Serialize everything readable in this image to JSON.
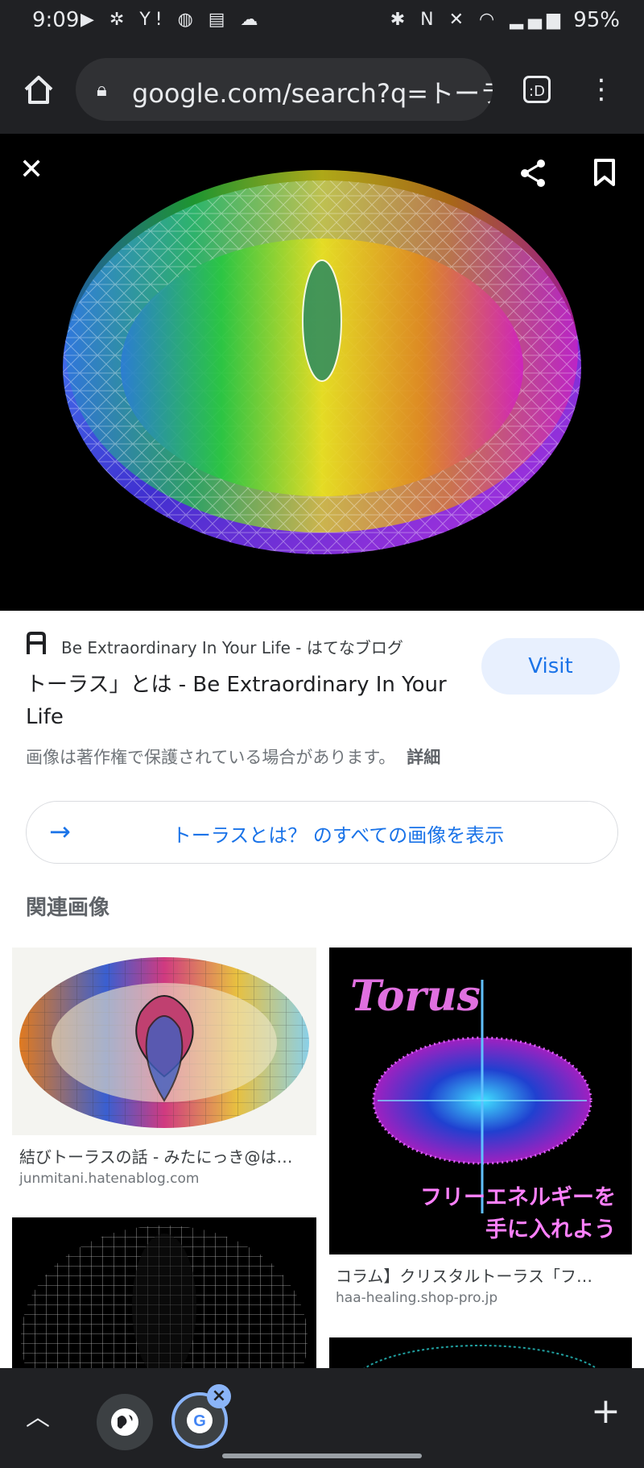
{
  "status": {
    "time": "9:09",
    "left_icons": "▶ ✲ Y! ◍ ▤ ☁",
    "right_icons": "✱ N ✕ ◠ ▂▄▆",
    "battery": "95%"
  },
  "browser": {
    "url": "google.com/search?q=トーラ",
    "tab_count": ":D"
  },
  "result": {
    "source": "Be Extraordinary In Your Life - はてなブログ",
    "title": "トーラス」とは - Be Extraordinary In Your Life",
    "visit_label": "Visit",
    "copyright": "画像は著作権で保護されている場合があります。",
    "detail_label": "詳細",
    "view_all_label": "トーラスとは？ のすべての画像を表示"
  },
  "related": {
    "heading": "関連画像",
    "items": [
      {
        "caption": "結びトーラスの話 - みたにっき@は…",
        "domain": "junmitani.hatenablog.com"
      },
      {
        "caption": "コラム】クリスタルトーラス「フ…",
        "domain": "haa-healing.shop-pro.jp",
        "image_text_1": "Torus",
        "image_text_2": "フリーエネルギーを",
        "image_text_3": "手に入れよう"
      }
    ]
  },
  "colors": {
    "accent": "#1a73e8",
    "dark_bg": "#202124"
  }
}
